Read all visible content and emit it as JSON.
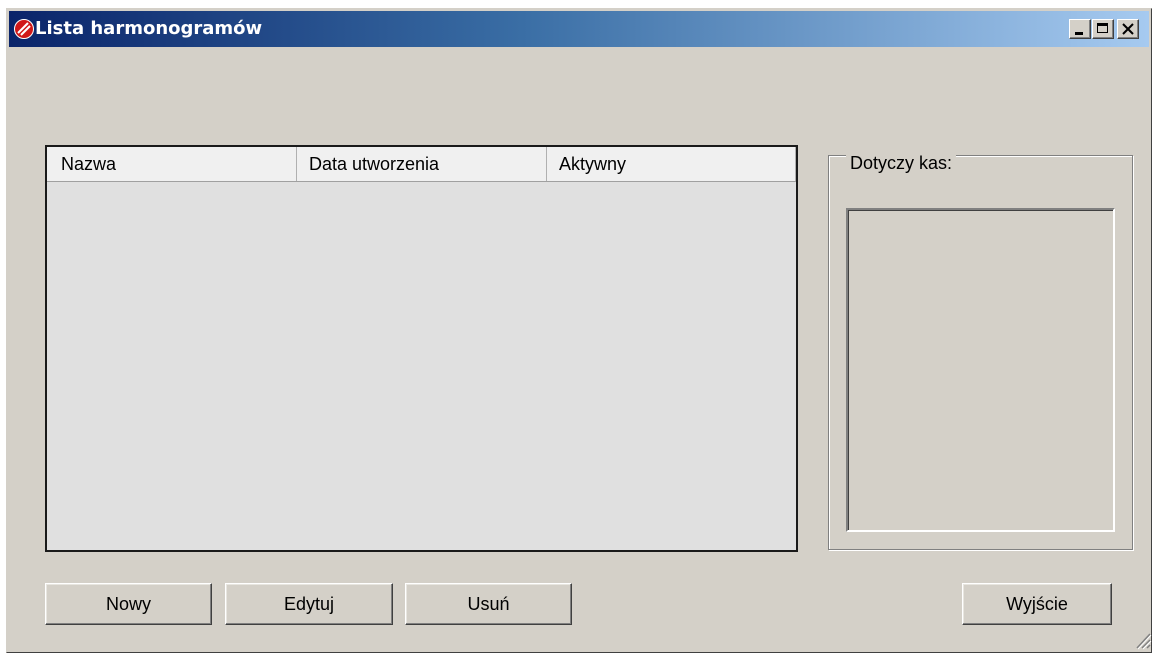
{
  "window": {
    "title": "Lista harmonogramów"
  },
  "titlebar_buttons": {
    "minimize_icon": "minimize-icon",
    "maximize_icon": "maximize-icon",
    "close_icon": "close-icon"
  },
  "list": {
    "columns": [
      "Nazwa",
      "Data utworzenia",
      "Aktywny"
    ],
    "rows": []
  },
  "kasy_group": {
    "label": "Dotyczy kas:",
    "items": []
  },
  "buttons": {
    "new": "Nowy",
    "edit": "Edytuj",
    "delete": "Usuń",
    "exit": "Wyjście"
  },
  "colors": {
    "titlebar_start": "#0a246a",
    "titlebar_end": "#a6caf0",
    "face": "#d4d0c8",
    "list_bg": "#e0e0e0"
  }
}
